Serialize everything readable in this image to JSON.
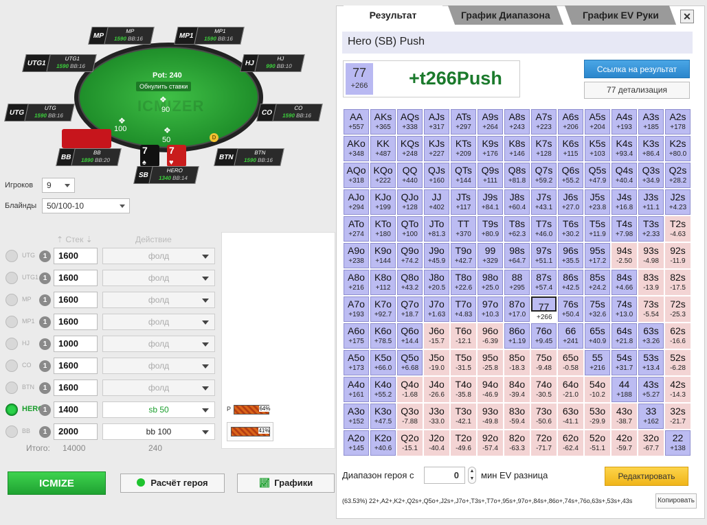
{
  "table": {
    "pot": "Pot: 240",
    "reset_btn": "Обнулить ставки",
    "watermark": "ICMIZER",
    "chip_center": "90",
    "chip_sb": "50",
    "chip_left": "100",
    "dealer": "D",
    "hero_cards": [
      {
        "rank": "7",
        "suit": "♠",
        "color": "#111"
      },
      {
        "rank": "7",
        "suit": "♥",
        "color": "#c91c1c"
      }
    ],
    "seats": [
      {
        "pos": "MP",
        "name": "MP",
        "stack": "1590",
        "bb": "BB:16"
      },
      {
        "pos": "MP1",
        "name": "MP1",
        "stack": "1590",
        "bb": "BB:16"
      },
      {
        "pos": "UTG1",
        "name": "UTG1",
        "stack": "1590",
        "bb": "BB:16"
      },
      {
        "pos": "HJ",
        "name": "HJ",
        "stack": "990",
        "bb": "BB:10"
      },
      {
        "pos": "UTG",
        "name": "UTG",
        "stack": "1590",
        "bb": "BB:16"
      },
      {
        "pos": "CO",
        "name": "CO",
        "stack": "1590",
        "bb": "BB:16"
      },
      {
        "pos": "BB",
        "name": "BB",
        "stack": "1890",
        "bb": "BB:20"
      },
      {
        "pos": "BTN",
        "name": "BTN",
        "stack": "1590",
        "bb": "BB:16"
      },
      {
        "pos": "SB",
        "name": "HERO",
        "stack": "1340",
        "bb": "BB:14"
      }
    ]
  },
  "controls": {
    "players_label": "Игроков",
    "players_value": "9",
    "blinds_label": "Блайнды",
    "blinds_value": "50/100-10",
    "stack_header": "Стек",
    "action_header": "Действие",
    "rows": [
      {
        "pos": "UTG",
        "count": "1",
        "stack": "1600",
        "action": "фолд",
        "state": "off"
      },
      {
        "pos": "UTG1",
        "count": "1",
        "stack": "1600",
        "action": "фолд",
        "state": "off"
      },
      {
        "pos": "MP",
        "count": "1",
        "stack": "1600",
        "action": "фолд",
        "state": "off"
      },
      {
        "pos": "MP1",
        "count": "1",
        "stack": "1600",
        "action": "фолд",
        "state": "off"
      },
      {
        "pos": "HJ",
        "count": "1",
        "stack": "1000",
        "action": "фолд",
        "state": "off"
      },
      {
        "pos": "CO",
        "count": "1",
        "stack": "1600",
        "action": "фолд",
        "state": "off"
      },
      {
        "pos": "BTN",
        "count": "1",
        "stack": "1600",
        "action": "фолд",
        "state": "off"
      },
      {
        "pos": "HERO",
        "count": "1",
        "stack": "1400",
        "action": "sb 50",
        "state": "hero"
      },
      {
        "pos": "BB",
        "count": "1",
        "stack": "2000",
        "action": "bb 100",
        "state": "bb"
      }
    ],
    "total_label": "Итого:",
    "total_stack": "14000",
    "total_pot": "240",
    "equity_p_label": "P",
    "equity_p": "64%",
    "equity_p_fraction": 0.64,
    "equity_2": "41%",
    "equity_2_fraction": 0.41
  },
  "buttons": {
    "icmize": "ICMIZE",
    "hero_calc": "Расчёт героя",
    "charts": "Графики"
  },
  "panel": {
    "tabs": [
      "Результат",
      "График Диапазона",
      "График EV Руки"
    ],
    "close": "✕",
    "header": "Hero (SB) Push",
    "combo_hand": "77",
    "combo_ev": "+266",
    "combo_result": "+t266Push",
    "link_btn": "Ссылка на результат",
    "detail_btn": "77 детализация",
    "range_label": "Диапазон героя с",
    "range_value": "0",
    "min_ev_label": "мин EV разница",
    "edit_btn": "Редактировать",
    "range_text": "(63.53%) 22+,A2+,K2+,Q2s+,Q5o+,J2s+,J7o+,T3s+,T7o+,95s+,97o+,84s+,86o+,74s+,76o,63s+,53s+,43s",
    "copy_btn": "Копировать",
    "selected_hand": "77"
  },
  "grid": [
    [
      [
        "AA",
        "+557",
        "p"
      ],
      [
        "AKs",
        "+365",
        "p"
      ],
      [
        "AQs",
        "+338",
        "p"
      ],
      [
        "AJs",
        "+317",
        "p"
      ],
      [
        "ATs",
        "+297",
        "p"
      ],
      [
        "A9s",
        "+264",
        "p"
      ],
      [
        "A8s",
        "+243",
        "p"
      ],
      [
        "A7s",
        "+223",
        "p"
      ],
      [
        "A6s",
        "+206",
        "p"
      ],
      [
        "A5s",
        "+204",
        "p"
      ],
      [
        "A4s",
        "+193",
        "p"
      ],
      [
        "A3s",
        "+185",
        "p"
      ],
      [
        "A2s",
        "+178",
        "p"
      ]
    ],
    [
      [
        "AKo",
        "+348",
        "p"
      ],
      [
        "KK",
        "+487",
        "p"
      ],
      [
        "KQs",
        "+248",
        "p"
      ],
      [
        "KJs",
        "+227",
        "p"
      ],
      [
        "KTs",
        "+209",
        "p"
      ],
      [
        "K9s",
        "+176",
        "p"
      ],
      [
        "K8s",
        "+146",
        "p"
      ],
      [
        "K7s",
        "+128",
        "p"
      ],
      [
        "K6s",
        "+115",
        "p"
      ],
      [
        "K5s",
        "+103",
        "p"
      ],
      [
        "K4s",
        "+93.4",
        "p"
      ],
      [
        "K3s",
        "+86.4",
        "p"
      ],
      [
        "K2s",
        "+80.0",
        "p"
      ]
    ],
    [
      [
        "AQo",
        "+318",
        "p"
      ],
      [
        "KQo",
        "+222",
        "p"
      ],
      [
        "QQ",
        "+440",
        "p"
      ],
      [
        "QJs",
        "+160",
        "p"
      ],
      [
        "QTs",
        "+144",
        "p"
      ],
      [
        "Q9s",
        "+111",
        "p"
      ],
      [
        "Q8s",
        "+81.8",
        "p"
      ],
      [
        "Q7s",
        "+59.2",
        "p"
      ],
      [
        "Q6s",
        "+55.2",
        "p"
      ],
      [
        "Q5s",
        "+47.9",
        "p"
      ],
      [
        "Q4s",
        "+40.4",
        "p"
      ],
      [
        "Q3s",
        "+34.9",
        "p"
      ],
      [
        "Q2s",
        "+28.2",
        "p"
      ]
    ],
    [
      [
        "AJo",
        "+294",
        "p"
      ],
      [
        "KJo",
        "+199",
        "p"
      ],
      [
        "QJo",
        "+128",
        "p"
      ],
      [
        "JJ",
        "+402",
        "p"
      ],
      [
        "JTs",
        "+117",
        "p"
      ],
      [
        "J9s",
        "+84.1",
        "p"
      ],
      [
        "J8s",
        "+60.4",
        "p"
      ],
      [
        "J7s",
        "+43.1",
        "p"
      ],
      [
        "J6s",
        "+27.0",
        "p"
      ],
      [
        "J5s",
        "+23.8",
        "p"
      ],
      [
        "J4s",
        "+16.8",
        "p"
      ],
      [
        "J3s",
        "+11.1",
        "p"
      ],
      [
        "J2s",
        "+4.23",
        "p"
      ]
    ],
    [
      [
        "ATo",
        "+274",
        "p"
      ],
      [
        "KTo",
        "+180",
        "p"
      ],
      [
        "QTo",
        "+100",
        "p"
      ],
      [
        "JTo",
        "+81.3",
        "p"
      ],
      [
        "TT",
        "+370",
        "p"
      ],
      [
        "T9s",
        "+80.9",
        "p"
      ],
      [
        "T8s",
        "+62.3",
        "p"
      ],
      [
        "T7s",
        "+46.0",
        "p"
      ],
      [
        "T6s",
        "+30.2",
        "p"
      ],
      [
        "T5s",
        "+11.9",
        "p"
      ],
      [
        "T4s",
        "+7.98",
        "p"
      ],
      [
        "T3s",
        "+2.33",
        "p"
      ],
      [
        "T2s",
        "-4.63",
        "n"
      ]
    ],
    [
      [
        "A9o",
        "+238",
        "p"
      ],
      [
        "K9o",
        "+144",
        "p"
      ],
      [
        "Q9o",
        "+74.2",
        "p"
      ],
      [
        "J9o",
        "+45.9",
        "p"
      ],
      [
        "T9o",
        "+42.7",
        "p"
      ],
      [
        "99",
        "+329",
        "p"
      ],
      [
        "98s",
        "+64.7",
        "p"
      ],
      [
        "97s",
        "+51.1",
        "p"
      ],
      [
        "96s",
        "+35.5",
        "p"
      ],
      [
        "95s",
        "+17.2",
        "p"
      ],
      [
        "94s",
        "-2.50",
        "n"
      ],
      [
        "93s",
        "-4.98",
        "n"
      ],
      [
        "92s",
        "-11.9",
        "n"
      ]
    ],
    [
      [
        "A8o",
        "+216",
        "p"
      ],
      [
        "K8o",
        "+112",
        "p"
      ],
      [
        "Q8o",
        "+43.2",
        "p"
      ],
      [
        "J8o",
        "+20.5",
        "p"
      ],
      [
        "T8o",
        "+22.6",
        "p"
      ],
      [
        "98o",
        "+25.0",
        "p"
      ],
      [
        "88",
        "+295",
        "p"
      ],
      [
        "87s",
        "+57.4",
        "p"
      ],
      [
        "86s",
        "+42.5",
        "p"
      ],
      [
        "85s",
        "+24.2",
        "p"
      ],
      [
        "84s",
        "+4.66",
        "p"
      ],
      [
        "83s",
        "-13.9",
        "n"
      ],
      [
        "82s",
        "-17.5",
        "n"
      ]
    ],
    [
      [
        "A7o",
        "+193",
        "p"
      ],
      [
        "K7o",
        "+92.7",
        "p"
      ],
      [
        "Q7o",
        "+18.7",
        "p"
      ],
      [
        "J7o",
        "+1.63",
        "p"
      ],
      [
        "T7o",
        "+4.83",
        "p"
      ],
      [
        "97o",
        "+10.3",
        "p"
      ],
      [
        "87o",
        "+17.0",
        "p"
      ],
      [
        "77",
        "+266",
        "p"
      ],
      [
        "76s",
        "+50.4",
        "p"
      ],
      [
        "75s",
        "+32.6",
        "p"
      ],
      [
        "74s",
        "+13.0",
        "p"
      ],
      [
        "73s",
        "-5.54",
        "n"
      ],
      [
        "72s",
        "-25.3",
        "n"
      ]
    ],
    [
      [
        "A6o",
        "+175",
        "p"
      ],
      [
        "K6o",
        "+78.5",
        "p"
      ],
      [
        "Q6o",
        "+14.4",
        "p"
      ],
      [
        "J6o",
        "-15.7",
        "n"
      ],
      [
        "T6o",
        "-12.1",
        "n"
      ],
      [
        "96o",
        "-6.39",
        "n"
      ],
      [
        "86o",
        "+1.19",
        "p"
      ],
      [
        "76o",
        "+9.45",
        "p"
      ],
      [
        "66",
        "+241",
        "p"
      ],
      [
        "65s",
        "+40.9",
        "p"
      ],
      [
        "64s",
        "+21.8",
        "p"
      ],
      [
        "63s",
        "+3.26",
        "p"
      ],
      [
        "62s",
        "-16.6",
        "n"
      ]
    ],
    [
      [
        "A5o",
        "+173",
        "p"
      ],
      [
        "K5o",
        "+66.0",
        "p"
      ],
      [
        "Q5o",
        "+6.68",
        "p"
      ],
      [
        "J5o",
        "-19.0",
        "n"
      ],
      [
        "T5o",
        "-31.5",
        "n"
      ],
      [
        "95o",
        "-25.8",
        "n"
      ],
      [
        "85o",
        "-18.3",
        "n"
      ],
      [
        "75o",
        "-9.48",
        "n"
      ],
      [
        "65o",
        "-0.58",
        "n"
      ],
      [
        "55",
        "+216",
        "p"
      ],
      [
        "54s",
        "+31.7",
        "p"
      ],
      [
        "53s",
        "+13.4",
        "p"
      ],
      [
        "52s",
        "-6.28",
        "n"
      ]
    ],
    [
      [
        "A4o",
        "+161",
        "p"
      ],
      [
        "K4o",
        "+55.2",
        "p"
      ],
      [
        "Q4o",
        "-1.68",
        "n"
      ],
      [
        "J4o",
        "-26.6",
        "n"
      ],
      [
        "T4o",
        "-35.8",
        "n"
      ],
      [
        "94o",
        "-46.9",
        "n"
      ],
      [
        "84o",
        "-39.4",
        "n"
      ],
      [
        "74o",
        "-30.5",
        "n"
      ],
      [
        "64o",
        "-21.0",
        "n"
      ],
      [
        "54o",
        "-10.2",
        "n"
      ],
      [
        "44",
        "+188",
        "p"
      ],
      [
        "43s",
        "+5.27",
        "p"
      ],
      [
        "42s",
        "-14.3",
        "n"
      ]
    ],
    [
      [
        "A3o",
        "+152",
        "p"
      ],
      [
        "K3o",
        "+47.5",
        "p"
      ],
      [
        "Q3o",
        "-7.88",
        "n"
      ],
      [
        "J3o",
        "-33.0",
        "n"
      ],
      [
        "T3o",
        "-42.1",
        "n"
      ],
      [
        "93o",
        "-49.8",
        "n"
      ],
      [
        "83o",
        "-59.4",
        "n"
      ],
      [
        "73o",
        "-50.6",
        "n"
      ],
      [
        "63o",
        "-41.1",
        "n"
      ],
      [
        "53o",
        "-29.9",
        "n"
      ],
      [
        "43o",
        "-38.7",
        "n"
      ],
      [
        "33",
        "+162",
        "p"
      ],
      [
        "32s",
        "-21.7",
        "n"
      ]
    ],
    [
      [
        "A2o",
        "+145",
        "p"
      ],
      [
        "K2o",
        "+40.6",
        "p"
      ],
      [
        "Q2o",
        "-15.1",
        "n"
      ],
      [
        "J2o",
        "-40.4",
        "n"
      ],
      [
        "T2o",
        "-49.6",
        "n"
      ],
      [
        "92o",
        "-57.4",
        "n"
      ],
      [
        "82o",
        "-63.3",
        "n"
      ],
      [
        "72o",
        "-71.7",
        "n"
      ],
      [
        "62o",
        "-62.4",
        "n"
      ],
      [
        "52o",
        "-51.1",
        "n"
      ],
      [
        "42o",
        "-59.7",
        "n"
      ],
      [
        "32o",
        "-67.7",
        "n"
      ],
      [
        "22",
        "+138",
        "p"
      ]
    ]
  ]
}
